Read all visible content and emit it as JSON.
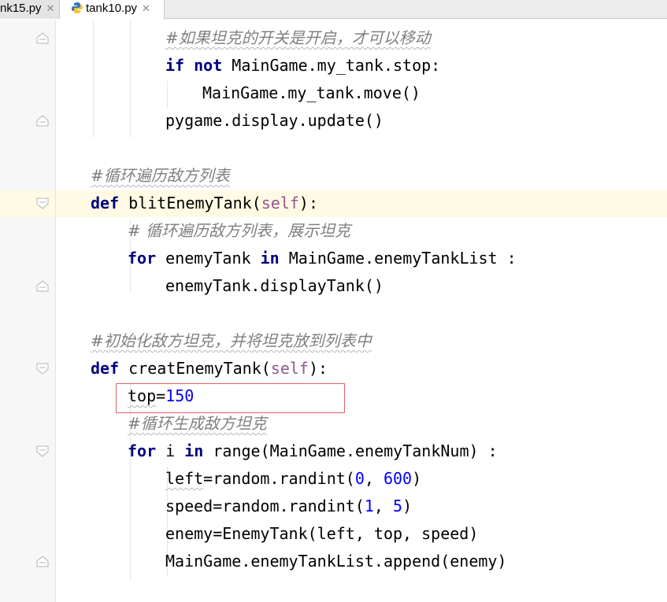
{
  "tabs": [
    {
      "label": "nk15.py",
      "close": "✕"
    },
    {
      "label": "tank10.py",
      "close": "✕",
      "icon": "python-file-icon"
    }
  ],
  "code": {
    "l1": {
      "comment": "#如果坦克的开关是开启，才可以移动"
    },
    "l2": {
      "kw1": "if",
      "kw2": "not",
      "text": " MainGame.my_tank.stop:"
    },
    "l3": {
      "text": "MainGame.my_tank.move()"
    },
    "l4": {
      "text": "pygame.display.update()"
    },
    "l5": {
      "comment": "#循环遍历敌方列表"
    },
    "l6": {
      "kw": "def",
      "name": " blitEnemyTank(",
      "self": "self",
      "end": "):"
    },
    "l7": {
      "comment": "# 循环遍历敌方列表，展示坦克"
    },
    "l8": {
      "kw1": "for",
      "mid": " enemyTank ",
      "kw2": "in",
      "text": " MainGame.enemyTankList ",
      "end": ":"
    },
    "l9": {
      "text": "enemyTank.displayTank()"
    },
    "l10": {
      "comment": "#初始化敌方坦克，并将坦克放到列表中"
    },
    "l11": {
      "kw": "def",
      "name": " creatEnemyTank(",
      "self": "self",
      "end": "):"
    },
    "l12": {
      "var": "top",
      "eq": "=",
      "num": "150"
    },
    "l13": {
      "comment": "#循环生成敌方坦克"
    },
    "l14": {
      "kw1": "for",
      "mid": " i ",
      "kw2": "in",
      "text": " range(MainGame.enemyTankNum) ",
      "end": ":"
    },
    "l15": {
      "var": "left",
      "text": "=random.randint(",
      "n1": "0",
      "sep": ", ",
      "n2": "600",
      "end": ")"
    },
    "l16": {
      "var": "speed",
      "text": "=random.randint(",
      "n1": "1",
      "sep": ", ",
      "n2": "5",
      "end": ")"
    },
    "l17": {
      "text": "enemy=EnemyTank(left, top, speed)"
    },
    "l18": {
      "text": "MainGame.enemyTankList.append(enemy)"
    }
  }
}
